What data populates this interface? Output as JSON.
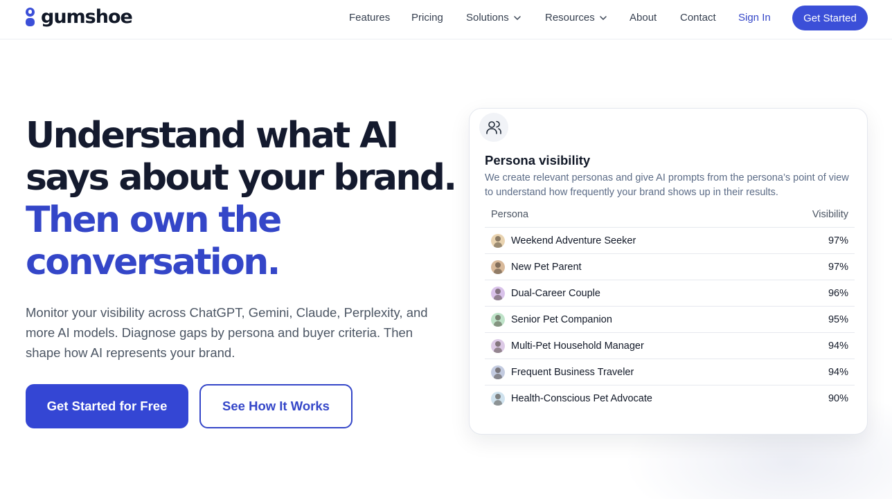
{
  "header": {
    "logo_text": "gumshoe",
    "nav": [
      {
        "label": "Features"
      },
      {
        "label": "Pricing"
      },
      {
        "label": "Solutions",
        "dropdown": true
      },
      {
        "label": "Resources",
        "dropdown": true
      },
      {
        "label": "About"
      },
      {
        "label": "Contact"
      }
    ],
    "sign_in": "Sign In",
    "get_started": "Get Started"
  },
  "hero": {
    "title_line1": "Understand what AI",
    "title_line2": "says about your brand.",
    "title_line3": "Then own the",
    "title_line4": "conversation.",
    "subtitle": "Monitor your visibility across ChatGPT, Gemini, Claude, Perplexity, and more AI models. Diagnose gaps by persona and buyer criteria. Then shape how AI represents your brand.",
    "primary_cta": "Get Started for Free",
    "secondary_cta": "See How It Works"
  },
  "card": {
    "icon": "users-icon",
    "title": "Persona visibility",
    "description": "We create relevant personas and give AI prompts from the persona’s point of view to understand how frequently your brand shows up in their results.",
    "columns": [
      "Persona",
      "Visibility"
    ],
    "rows": [
      {
        "persona": "Weekend Adventure Seeker",
        "visibility": "97%",
        "avatar_color": "#e9d3b0"
      },
      {
        "persona": "New Pet Parent",
        "visibility": "97%",
        "avatar_color": "#d8b99a"
      },
      {
        "persona": "Dual-Career Couple",
        "visibility": "96%",
        "avatar_color": "#d9c2ea"
      },
      {
        "persona": "Senior Pet Companion",
        "visibility": "95%",
        "avatar_color": "#bfe3c9"
      },
      {
        "persona": "Multi-Pet Household Manager",
        "visibility": "94%",
        "avatar_color": "#dcc9e6"
      },
      {
        "persona": "Frequent Business Traveler",
        "visibility": "94%",
        "avatar_color": "#c3cbe0"
      },
      {
        "persona": "Health-Conscious Pet Advocate",
        "visibility": "90%",
        "avatar_color": "#cfe2ee"
      }
    ]
  },
  "colors": {
    "accent": "#3446c8",
    "button": "#3b4fd8",
    "heading_dark": "#141a2e"
  }
}
